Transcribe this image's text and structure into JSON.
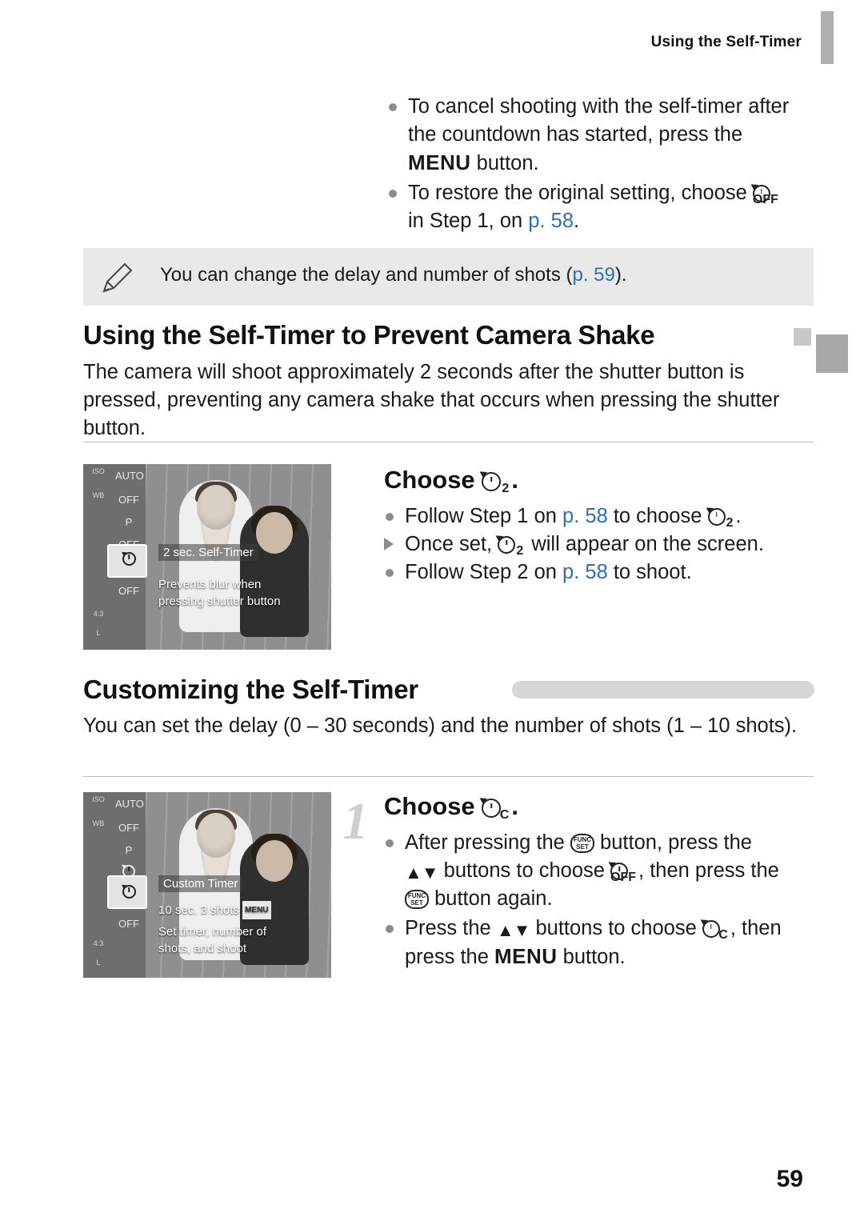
{
  "header": {
    "running_head": "Using the Self-Timer",
    "page_number": "59"
  },
  "top_bullets": [
    {
      "marker": "dot",
      "lines": [
        "To cancel shooting with the self-timer after",
        "the countdown has started, press the",
        "MENU button."
      ]
    },
    {
      "marker": "dot",
      "lines": [
        "To restore the original setting, choose [timer-off-icon]",
        "in Step 1, on p. 58."
      ]
    }
  ],
  "note": {
    "icon": "pencil-icon",
    "text_before": "You can change the delay and number of shots (",
    "link": "p. 59",
    "text_after": ")."
  },
  "section1": {
    "heading": "Using the Self-Timer to Prevent Camera Shake",
    "paragraph": "The camera will shoot approximately 2 seconds after the shutter button is pressed, preventing any camera shake that occurs when pressing the shutter button.",
    "screen": {
      "menu_label": "2 sec. Self-Timer",
      "hint_line1": "Prevents blur when",
      "hint_line2": "pressing shutter button",
      "left_labels": [
        "4:3"
      ],
      "mode_letter": "P"
    },
    "step_title": "Choose",
    "step_title_icon": "self-timer-2sec-icon",
    "bullets": [
      {
        "marker": "dot",
        "text_parts": [
          "Follow Step 1 on ",
          "p. 58",
          " to choose ",
          "[self-timer-2sec-icon]",
          "."
        ]
      },
      {
        "marker": "arrow",
        "text_parts": [
          "Once set, ",
          "[self-timer-2sec-icon]",
          " will appear on the screen."
        ]
      },
      {
        "marker": "dot",
        "text_parts": [
          "Follow Step 2 on ",
          "p. 58",
          " to shoot."
        ]
      }
    ]
  },
  "section2": {
    "heading": "Customizing the Self-Timer",
    "paragraph": "You can set the delay (0 – 30 seconds) and the number of shots (1 – 10 shots).",
    "step_number": "1",
    "step_title": "Choose",
    "step_title_icon": "custom-timer-icon",
    "screen": {
      "menu_label": "Custom Timer",
      "value_label": "10 sec. 3 shots",
      "value_chip": "MENU",
      "hint_line1": "Set timer, number of",
      "hint_line2": "shots, and shoot",
      "mode_letter": "P",
      "left_labels": [
        "4:3"
      ]
    },
    "bullets": [
      {
        "marker": "dot",
        "lines": [
          "After pressing the [func-set-icon] button, press the",
          "[up-down-icon] buttons to choose [timer-off-icon], then press the",
          "[func-set-icon] button again."
        ]
      },
      {
        "marker": "dot",
        "lines": [
          "Press the [up-down-icon] buttons to choose [custom-timer-icon], then",
          "press the MENU button."
        ]
      }
    ]
  },
  "colors": {
    "link": "#2f6fb5",
    "note_bg": "#e9e9e9",
    "heading_bar": "#d6d6d6",
    "tab": "#b0b0b0"
  }
}
